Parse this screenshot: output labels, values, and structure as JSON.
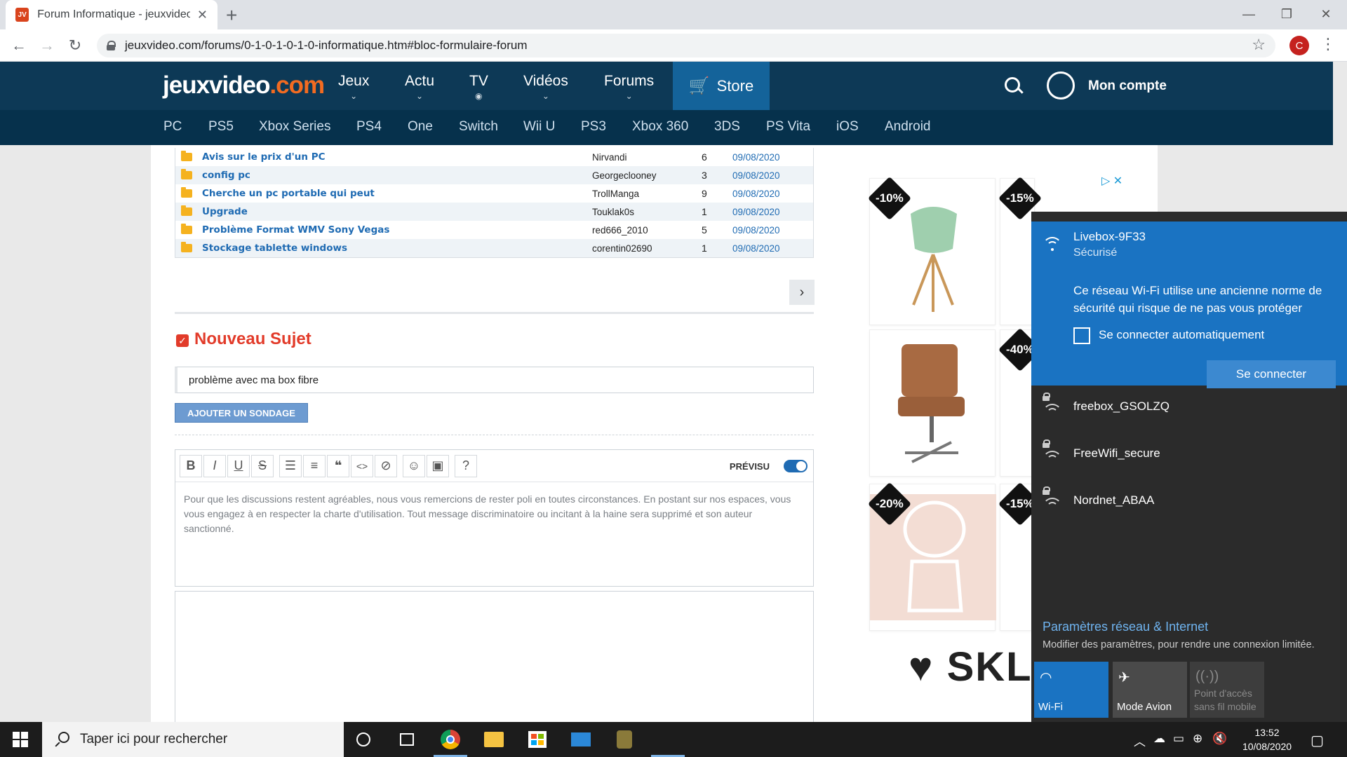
{
  "browser": {
    "tab_title": "Forum Informatique - jeuxvideo.c",
    "url": "jeuxvideo.com/forums/0-1-0-1-0-1-0-informatique.htm#bloc-formulaire-forum",
    "profile_initial": "C"
  },
  "site": {
    "logo_main": "jeuxvideo",
    "logo_tld": ".com",
    "main_nav": [
      "Jeux",
      "Actu",
      "TV",
      "Vidéos",
      "Forums"
    ],
    "store_label": "Store",
    "account_label": "Mon compte",
    "platforms": [
      "PC",
      "PS5",
      "Xbox Series",
      "PS4",
      "One",
      "Switch",
      "Wii U",
      "PS3",
      "Xbox 360",
      "3DS",
      "PS Vita",
      "iOS",
      "Android"
    ]
  },
  "topics": [
    {
      "title": "Avis sur le prix d'un PC",
      "author": "Nirvandi",
      "count": "6",
      "date": "09/08/2020"
    },
    {
      "title": "config pc",
      "author": "Georgeclooney",
      "count": "3",
      "date": "09/08/2020"
    },
    {
      "title": "Cherche un pc portable qui peut",
      "author": "TrollManga",
      "count": "9",
      "date": "09/08/2020"
    },
    {
      "title": "Upgrade",
      "author": "Touklak0s",
      "count": "1",
      "date": "09/08/2020"
    },
    {
      "title": "Problème Format WMV Sony Vegas",
      "author": "red666_2010",
      "count": "5",
      "date": "09/08/2020"
    },
    {
      "title": "Stockage tablette windows",
      "author": "corentin02690",
      "count": "1",
      "date": "09/08/2020"
    }
  ],
  "new_topic": {
    "heading": "Nouveau Sujet",
    "subject_value": "problème avec ma box fibre",
    "poll_button": "AJOUTER UN SONDAGE",
    "preview_label": "PRÉVISU",
    "preview_enabled": true,
    "body_placeholder": "Pour que les discussions restent agréables, nous vous remercions de rester poli en toutes circonstances. En postant sur nos espaces, vous vous engagez à en respecter la charte d'utilisation. Tout message discriminatoire ou incitant à la haine sera supprimé et son auteur sanctionné."
  },
  "ad": {
    "badges": [
      "-10%",
      "-15%",
      "-40%",
      "-20%",
      "-15%"
    ],
    "brand": "SKLU"
  },
  "network_flyout": {
    "selected": {
      "name": "Livebox-9F33",
      "status": "Sécurisé",
      "warning": "Ce réseau Wi-Fi utilise une ancienne norme de sécurité qui risque de ne pas vous protéger",
      "auto_connect_label": "Se connecter automatiquement",
      "auto_connect_checked": false,
      "connect_button": "Se connecter"
    },
    "networks": [
      "freebox_GSOLZQ",
      "FreeWifi_secure",
      "Nordnet_ABAA"
    ],
    "settings_link": "Paramètres réseau & Internet",
    "settings_desc": "Modifier des paramètres, pour rendre une connexion limitée.",
    "quick_tiles": [
      {
        "label": "Wi-Fi",
        "active": true
      },
      {
        "label": "Mode Avion",
        "active": false
      },
      {
        "label": "Point d'accès sans fil mobile",
        "active": false,
        "disabled": true
      }
    ]
  },
  "taskbar": {
    "search_placeholder": "Taper ici pour rechercher",
    "time": "13:52",
    "date": "10/08/2020"
  },
  "colors": {
    "site_header": "#0d3956",
    "site_subnav": "#06314c",
    "store": "#14639a",
    "accent_red": "#e23b2a",
    "link_blue": "#1f6bb3",
    "flyout_selected": "#1a73c2",
    "flyout_bg": "#2b2b2b"
  }
}
